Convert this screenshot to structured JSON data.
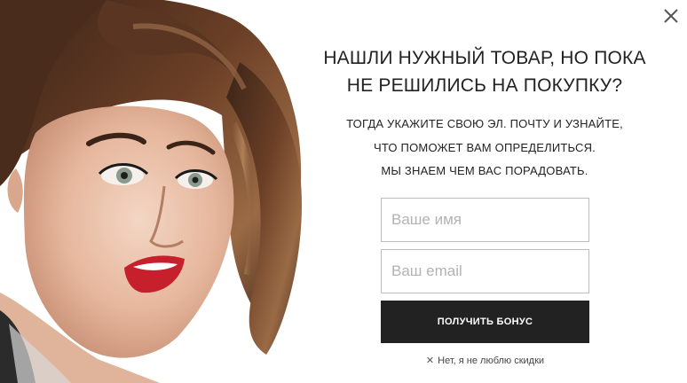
{
  "popup": {
    "headline": [
      "НАШЛИ НУЖНЫЙ ТОВАР, НО ПОКА",
      "НЕ РЕШИЛИСЬ НА ПОКУПКУ?"
    ],
    "subtext": [
      "ТОГДА УКАЖИТЕ СВОЮ ЭЛ. ПОЧТУ И УЗНАЙТЕ,",
      "ЧТО ПОМОЖЕТ ВАМ ОПРЕДЕЛИТЬСЯ.",
      "МЫ ЗНАЕМ ЧЕМ ВАС ПОРАДОВАТЬ."
    ],
    "name_placeholder": "Ваше имя",
    "email_placeholder": "Ваш email",
    "submit_label": "ПОЛУЧИТЬ БОНУС",
    "decline_label": "Нет, я не люблю скидки",
    "decline_icon": "✕",
    "close_icon": "close-icon"
  }
}
